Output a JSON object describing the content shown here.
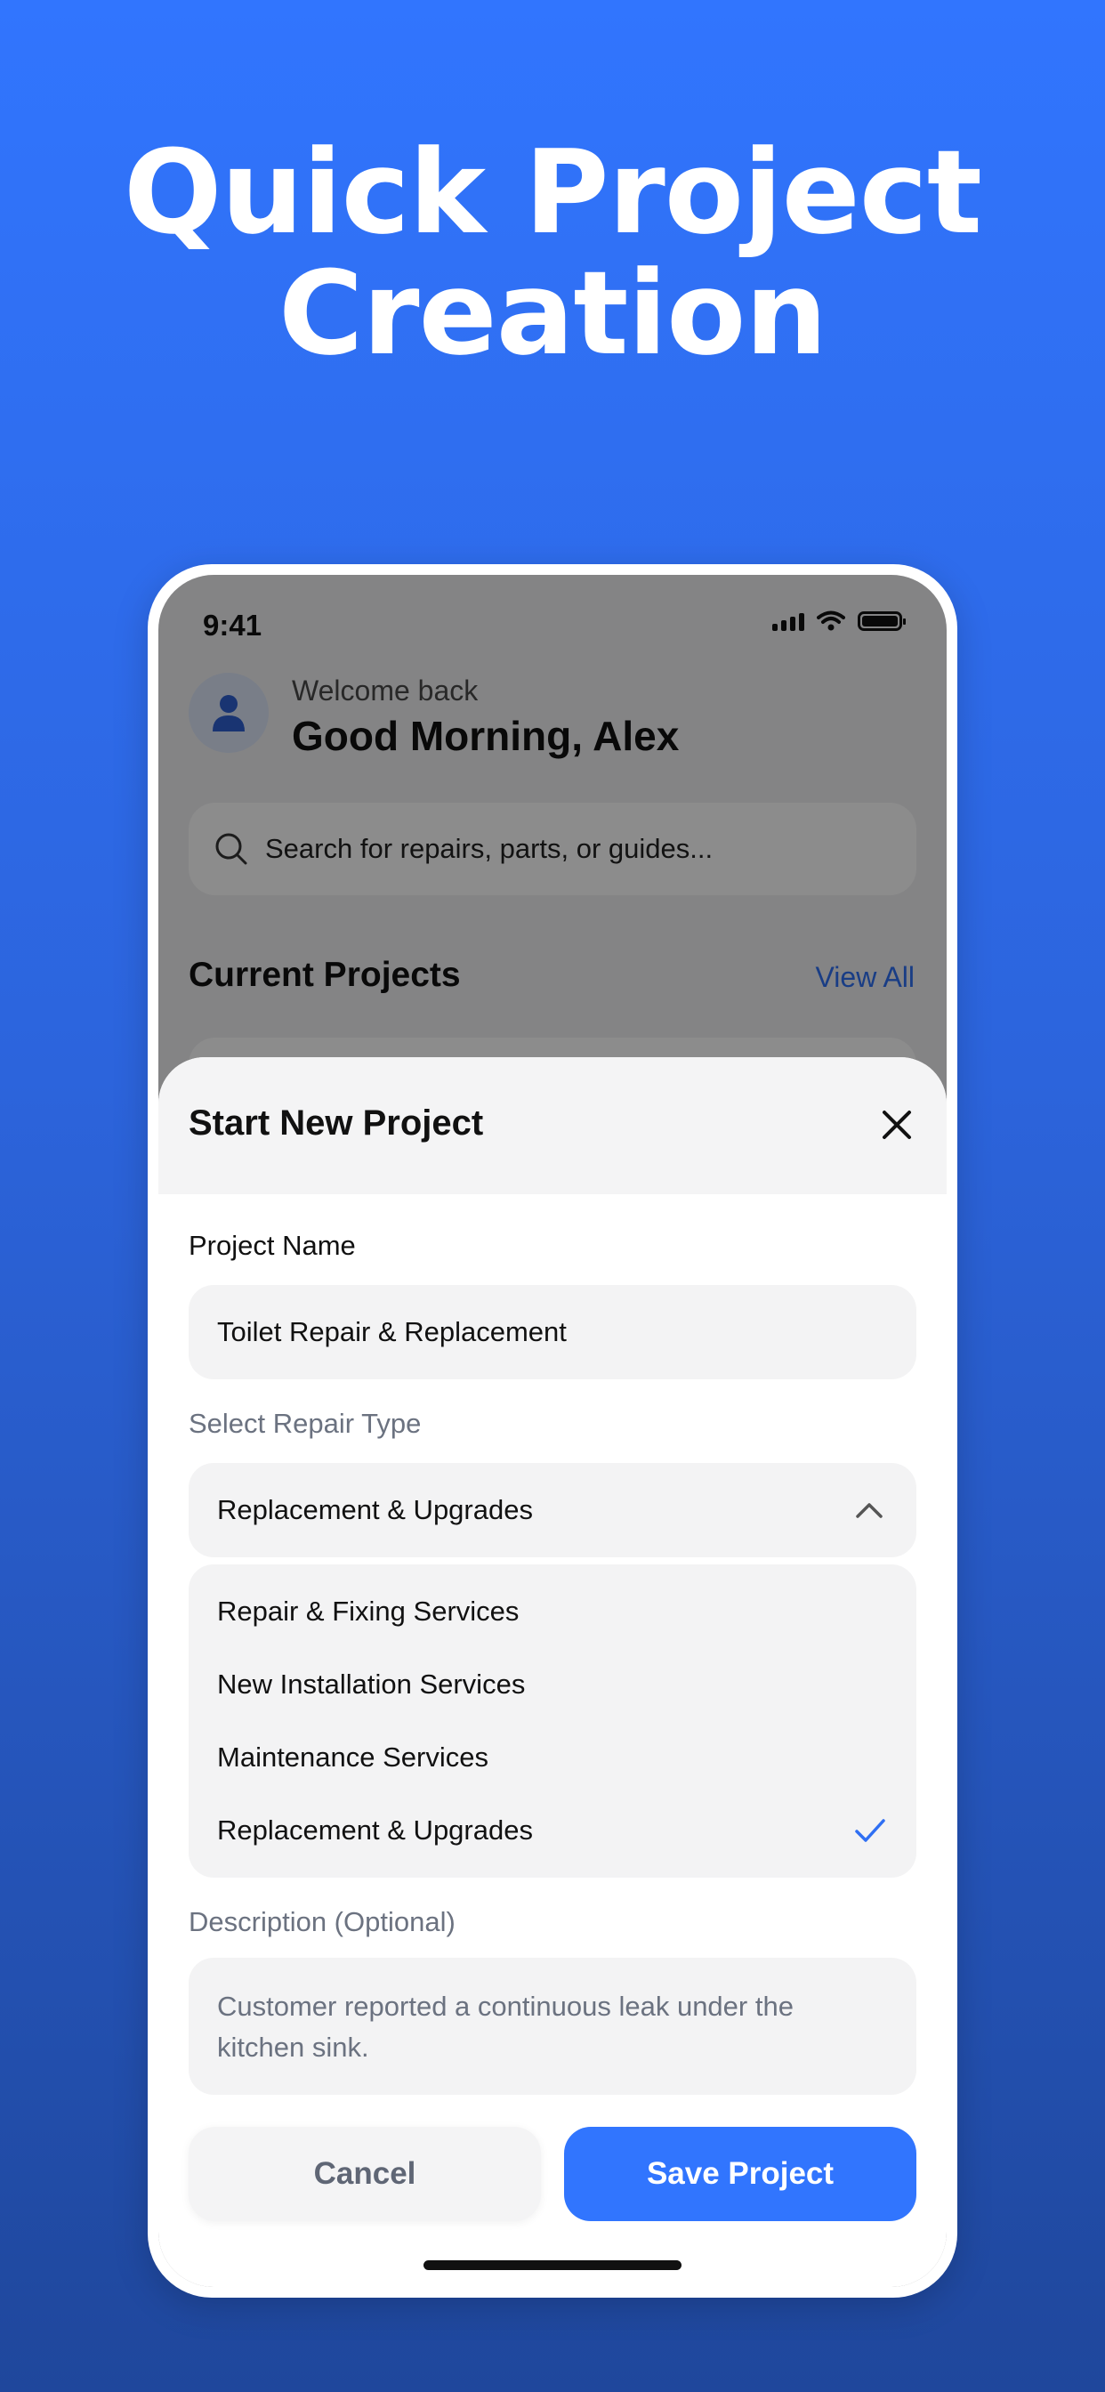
{
  "headline": {
    "line1": "Quick Project",
    "line2": "Creation"
  },
  "status_bar": {
    "time": "9:41"
  },
  "home": {
    "welcome": "Welcome back",
    "greeting": "Good Morning, Alex",
    "search_placeholder": "Search for repairs, parts, or guides...",
    "section_title": "Current Projects",
    "view_all": "View All"
  },
  "sheet": {
    "title": "Start New Project",
    "project_name_label": "Project Name",
    "project_name_value": "Toilet Repair & Replacement",
    "repair_type_label": "Select Repair Type",
    "repair_type_selected": "Replacement & Upgrades",
    "repair_type_options": [
      "Repair & Fixing Services",
      "New Installation Services",
      "Maintenance Services",
      "Replacement & Upgrades"
    ],
    "description_label": "Description (Optional)",
    "description_value": "Customer reported a continuous leak under the kitchen sink.",
    "cancel_label": "Cancel",
    "save_label": "Save Project"
  },
  "colors": {
    "accent": "#3175fe",
    "background_top": "#3175fe",
    "background_bottom": "#1f479c"
  }
}
